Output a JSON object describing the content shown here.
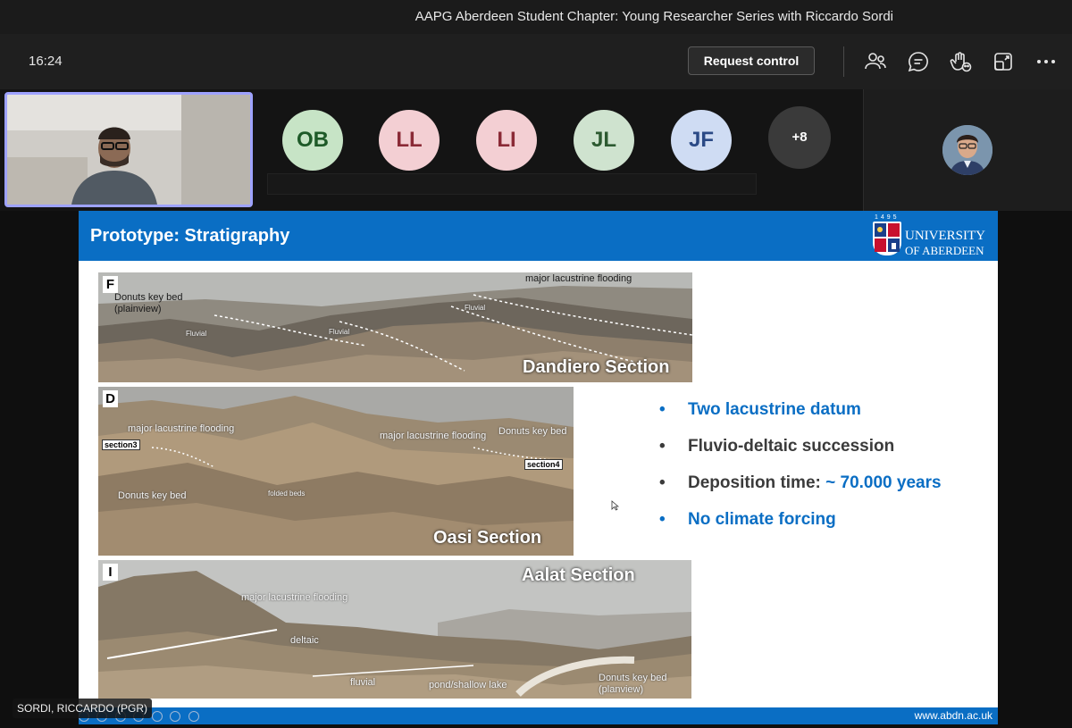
{
  "window": {
    "title": "AAPG Aberdeen Student Chapter: Young Researcher Series with Riccardo Sordi"
  },
  "toolbar": {
    "time": "16:24",
    "request_control": "Request control",
    "icons": [
      "people-icon",
      "chat-icon",
      "reactions-icon",
      "share-tray-icon",
      "more-options-icon"
    ]
  },
  "participants": {
    "avatars": [
      {
        "initials": "OB",
        "bg": "#c7e4c6",
        "fg": "#1e5a28"
      },
      {
        "initials": "LL",
        "bg": "#f3cfd3",
        "fg": "#8a2a36"
      },
      {
        "initials": "LI",
        "bg": "#f3cfd3",
        "fg": "#8a2a36"
      },
      {
        "initials": "JL",
        "bg": "#cfe3cf",
        "fg": "#2d5a31"
      },
      {
        "initials": "JF",
        "bg": "#cfdcf3",
        "fg": "#2b4a86"
      }
    ],
    "more": "+8"
  },
  "slide": {
    "title": "Prototype: Stratigraphy",
    "logo": {
      "year": "1495",
      "line1": "UNIVERSITY",
      "line2": "OF ABERDEEN"
    },
    "footer_url": "www.abdn.ac.uk",
    "panels": {
      "f": {
        "letter": "F",
        "section": "Dandiero  Section",
        "labels": {
          "donuts": "Donuts key bed",
          "plainview": "(plainview)",
          "flooding": "major lacustrine flooding",
          "fluvial_a": "Fluvial",
          "fluvial_b": "Fluvial",
          "fluvial_c": "Fluvial"
        }
      },
      "d": {
        "letter": "D",
        "section": "Oasi Section",
        "labels": {
          "flooding_a": "major lacustrine flooding",
          "flooding_b": "major lacustrine flooding",
          "section3": "section3",
          "section4": "section4",
          "donuts_a": "Donuts key bed",
          "donuts_b": "Donuts key bed",
          "folded": "folded beds"
        }
      },
      "i": {
        "letter": "I",
        "section": "Aalat  Section",
        "labels": {
          "flooding": "major lacustrine flooding",
          "deltaic": "deltaic",
          "fluvial": "fluvial",
          "pond": "pond/shallow lake",
          "donuts": "Donuts key bed",
          "planview": "(planview)"
        }
      }
    },
    "bullets": [
      {
        "dot": "•",
        "parts": [
          {
            "text": "Two lacustrine datum",
            "color": "blue"
          }
        ]
      },
      {
        "dot": "•",
        "parts": [
          {
            "text": "Fluvio-deltaic succession",
            "color": "dark"
          }
        ]
      },
      {
        "dot": "•",
        "parts": [
          {
            "text": "Deposition time: ",
            "color": "dark"
          },
          {
            "text": "~ 70.000 years",
            "color": "blue"
          }
        ]
      },
      {
        "dot": "•",
        "parts": [
          {
            "text": "No climate forcing",
            "color": "blue"
          }
        ]
      }
    ]
  },
  "presenter_name": "SORDI, RICCARDO (PGR)"
}
